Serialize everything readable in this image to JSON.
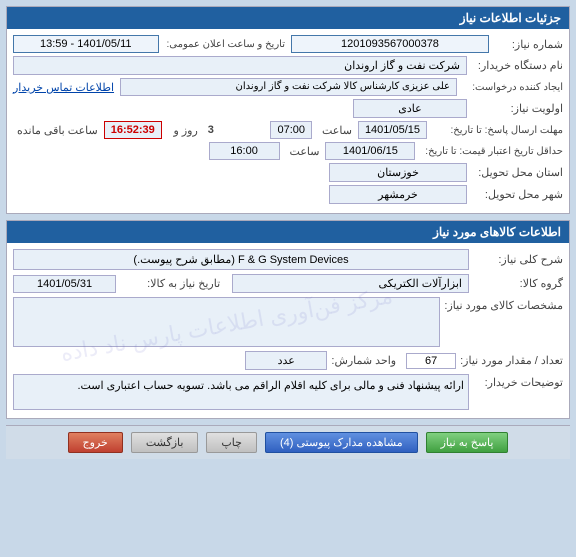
{
  "sections": {
    "info_header": "جزئیات اطلاعات نیاز",
    "products_header": "اطلاعات کالاهای مورد نیاز"
  },
  "info": {
    "serial_label": "شماره نیاز:",
    "serial_value": "1201093567000378",
    "datetime_label": "تاریخ و ساعت اعلان عمومی:",
    "datetime_value": "1401/05/11 - 13:59",
    "buyer_label": "نام دستگاه خریدار:",
    "buyer_value": "شرکت نفت و گاز اروندان",
    "requester_label": "ایجاد کننده درخواست:",
    "requester_value": "علی عزیزی کارشناس کالا شرکت نفت و گاز اروندان",
    "contact_link": "اطلاعات تماس خریدار",
    "priority_label": "اولویت نیاز:",
    "priority_value": "عادی",
    "send_from_label": "مهلت ارسال پاسخ: تا تاریخ:",
    "send_from_date": "1401/05/15",
    "send_from_time_label": "ساعت",
    "send_from_time": "07:00",
    "send_to_label": "حداقل تاریخ اعتبار قیمت: تا تاریخ:",
    "send_to_date": "1401/06/15",
    "send_to_time_label": "ساعت",
    "send_to_time": "16:00",
    "remaining_label": "ساعت باقی مانده",
    "remaining_days": "3",
    "remaining_day_label": "روز و",
    "remaining_time": "16:52:39",
    "province_label": "استان محل تحویل:",
    "province_value": "خوزستان",
    "city_label": "شهر محل تحویل:",
    "city_value": "خرمشهر"
  },
  "products": {
    "type_label": "شرح کلی نیاز:",
    "type_value": "F & G System Devices (مطابق شرح پیوست.)",
    "group_label": "گروه کالا:",
    "group_value": "ابزارآلات الکتریکی",
    "group_date_label": "تاریخ نیاز به کالا:",
    "group_date_value": "1401/05/31",
    "specs_label": "مشخصات کالای مورد نیاز:",
    "specs_value": "",
    "qty_label": "تعداد / مقدار مورد نیاز:",
    "qty_value": "67",
    "unit_label": "واحد شمارش:",
    "unit_value": "عدد",
    "desc_label": "توضیحات خریدار:",
    "desc_value": "ارائه پیشنهاد فنی و مالی برای کلیه اقلام الراقم می باشد. تسویه حساب اعتباری است."
  },
  "buttons": {
    "answer_label": "پاسخ به نیاز",
    "view_label": "مشاهده مدارک پیوستی (4)",
    "print_label": "چاپ",
    "back_label": "بازگشت",
    "exit_label": "خروج"
  }
}
